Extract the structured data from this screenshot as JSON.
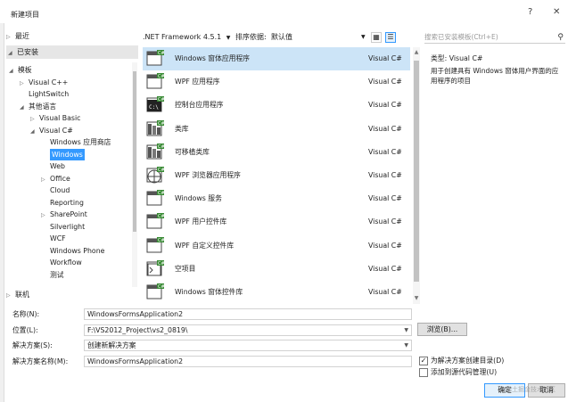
{
  "window": {
    "title": "新建项目",
    "help": "?",
    "close": "✕"
  },
  "tree": {
    "recent": "最近",
    "installed": "已安装",
    "items": [
      {
        "label": "模板",
        "indent": 0,
        "arrow": "◢"
      },
      {
        "label": "Visual C++",
        "indent": 1,
        "arrow": "▷"
      },
      {
        "label": "LightSwitch",
        "indent": 1,
        "arrow": ""
      },
      {
        "label": "其他语言",
        "indent": 1,
        "arrow": "◢"
      },
      {
        "label": "Visual Basic",
        "indent": 2,
        "arrow": "▷"
      },
      {
        "label": "Visual C#",
        "indent": 2,
        "arrow": "◢"
      },
      {
        "label": "Windows 应用商店",
        "indent": 3,
        "arrow": ""
      },
      {
        "label": "Windows",
        "indent": 3,
        "arrow": "",
        "selected": true
      },
      {
        "label": "Web",
        "indent": 3,
        "arrow": ""
      },
      {
        "label": "Office",
        "indent": 3,
        "arrow": "▷"
      },
      {
        "label": "Cloud",
        "indent": 3,
        "arrow": ""
      },
      {
        "label": "Reporting",
        "indent": 3,
        "arrow": ""
      },
      {
        "label": "SharePoint",
        "indent": 3,
        "arrow": "▷"
      },
      {
        "label": "Silverlight",
        "indent": 3,
        "arrow": ""
      },
      {
        "label": "WCF",
        "indent": 3,
        "arrow": ""
      },
      {
        "label": "Windows Phone",
        "indent": 3,
        "arrow": ""
      },
      {
        "label": "Workflow",
        "indent": 3,
        "arrow": ""
      },
      {
        "label": "测试",
        "indent": 3,
        "arrow": ""
      }
    ],
    "online": "联机"
  },
  "toolbar": {
    "framework": ".NET Framework 4.5.1",
    "sort_label": "排序依据:",
    "sort_value": "默认值"
  },
  "templates": [
    {
      "name": "Windows 窗体应用程序",
      "lang": "Visual C#",
      "selected": true,
      "icon": "winforms-icon"
    },
    {
      "name": "WPF 应用程序",
      "lang": "Visual C#",
      "icon": "wpf-app-icon"
    },
    {
      "name": "控制台应用程序",
      "lang": "Visual C#",
      "icon": "console-icon"
    },
    {
      "name": "类库",
      "lang": "Visual C#",
      "icon": "class-library-icon"
    },
    {
      "name": "可移植类库",
      "lang": "Visual C#",
      "icon": "portable-library-icon"
    },
    {
      "name": "WPF 浏览器应用程序",
      "lang": "Visual C#",
      "icon": "wpf-browser-icon"
    },
    {
      "name": "Windows 服务",
      "lang": "Visual C#",
      "icon": "service-icon"
    },
    {
      "name": "WPF 用户控件库",
      "lang": "Visual C#",
      "icon": "wpf-usercontrol-icon"
    },
    {
      "name": "WPF 自定义控件库",
      "lang": "Visual C#",
      "icon": "wpf-customcontrol-icon"
    },
    {
      "name": "空项目",
      "lang": "Visual C#",
      "icon": "empty-project-icon"
    },
    {
      "name": "Windows 窗体控件库",
      "lang": "Visual C#",
      "icon": "winforms-control-icon"
    }
  ],
  "search": {
    "placeholder": "搜索已安装模板(Ctrl+E)"
  },
  "info": {
    "type": "类型: Visual C#",
    "description": "用于创建具有 Windows 窗体用户界面的应用程序的项目"
  },
  "form": {
    "name_label": "名称(N):",
    "name_value": "WindowsFormsApplication2",
    "location_label": "位置(L):",
    "location_value": "F:\\VS2012_Project\\vs2_0819\\",
    "solution_label": "解决方案(S):",
    "solution_value": "创建新解决方案",
    "solution_name_label": "解决方案名称(M):",
    "solution_name_value": "WindowsFormsApplication2",
    "browse": "浏览(B)...",
    "create_dir": "为解决方案创建目录(D)",
    "create_dir_checked": true,
    "add_source": "添加到源代码管理(U)",
    "add_source_checked": false,
    "ok": "确定",
    "cancel": "取消",
    "watermark": "@稀土掘金技术社区"
  },
  "colors": {
    "selection": "#3399ff",
    "row_selected": "#cce4f7",
    "accent": "#68217a"
  }
}
